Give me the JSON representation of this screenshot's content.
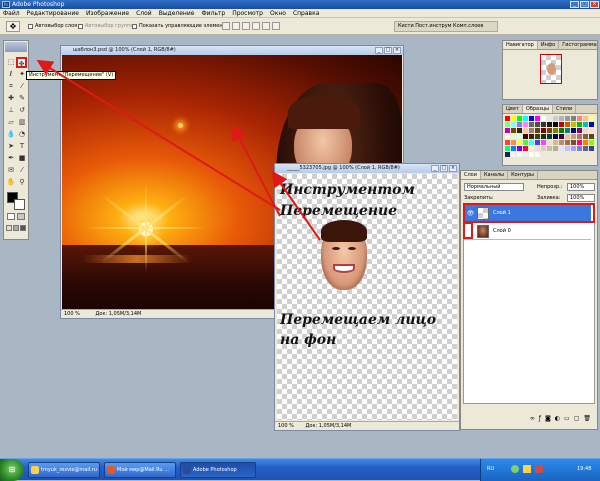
{
  "app": {
    "title": "Adobe Photoshop",
    "logo": "Ps"
  },
  "menu": [
    "Файл",
    "Редактирование",
    "Изображение",
    "Слой",
    "Выделение",
    "Фильтр",
    "Просмотр",
    "Окно",
    "Справка"
  ],
  "options": {
    "auto_select_layer": "Автовыбор слоя",
    "auto_select_group": "Автовыбор группы",
    "show_controls": "Показать управляющие элементы",
    "wells": "Кисти  Пост.инструм  Комп.слоев"
  },
  "tooltip": "Инструмент \"Перемещение\" (V)",
  "doc_bg": {
    "title": "шаблон3.psd @ 100% (Слой 1, RGB/8#)",
    "zoom": "100 %",
    "status": "Док: 1,05М/3,14М"
  },
  "doc_face": {
    "title": "_____5323705.jpg @ 100% (Слой 1, RGB/8#)",
    "zoom": "100 %",
    "status": "Док: 1,05М/3,14М"
  },
  "annotations": {
    "top_line1": "Инструментом",
    "top_line2": "Перемещение",
    "bottom_line1": "Перемещаем лицо",
    "bottom_line2": "на фон"
  },
  "navigator": {
    "tabs": [
      "Навигатор",
      "Инфо",
      "Гистограмма"
    ]
  },
  "swatches": {
    "tabs": [
      "Цвет",
      "Образцы",
      "Стили"
    ],
    "colors": [
      "#ff0000",
      "#ffff00",
      "#00ff00",
      "#00ffff",
      "#0000ff",
      "#ff00ff",
      "#ffffff",
      "#e6e6e6",
      "#cccccc",
      "#b3b3b3",
      "#999999",
      "#808080",
      "#ff8080",
      "#ffc080",
      "#ffff80",
      "#80ff80",
      "#80ffff",
      "#8080ff",
      "#ff80ff",
      "#666666",
      "#4d4d4d",
      "#333333",
      "#1a1a1a",
      "#000000",
      "#c00000",
      "#c06000",
      "#c0c000",
      "#00c000",
      "#00c0c0",
      "#0000c0",
      "#c000c0",
      "#804000",
      "#402000",
      "#f0d0a0",
      "#a08060",
      "#604020",
      "#800000",
      "#804000",
      "#808000",
      "#008000",
      "#008080",
      "#000080",
      "#800080",
      "#ffd0d0",
      "#ffe0c0",
      "#ffffd0",
      "#d0ffd0",
      "#d0ffff",
      "#400000",
      "#402000",
      "#404000",
      "#004000",
      "#004040",
      "#000040",
      "#400040",
      "#e8c0a0",
      "#c0a080",
      "#a08060",
      "#806040",
      "#604020",
      "#ff4040",
      "#ff9040",
      "#ffff40",
      "#40ff40",
      "#40ffff",
      "#4040ff",
      "#ff40ff",
      "#f4e0c8",
      "#d8b898",
      "#b89070",
      "#987050",
      "#785030",
      "#ff0080",
      "#ff8000",
      "#80ff00",
      "#00ff80",
      "#0080ff",
      "#8000ff",
      "#ff0040",
      "#ffeedd",
      "#eeddcc",
      "#ddccbb",
      "#ccbbaa",
      "#bbaa99",
      "#e0e0ff",
      "#c0c0ff",
      "#a0a0ff",
      "#8080c0",
      "#6060a0",
      "#404080",
      "#202060",
      "#fff0f0",
      "#f0fff0",
      "#f0f0ff",
      "#fffff0",
      "#f0ffff"
    ]
  },
  "layers": {
    "tabs": [
      "Слои",
      "Каналы",
      "Контуры"
    ],
    "blend_mode": "Нормальный",
    "opacity_label": "Непрозр.:",
    "opacity_value": "100%",
    "lock_label": "Закрепить:",
    "fill_label": "Заливка:",
    "fill_value": "100%",
    "items": [
      {
        "name": "Слой 1",
        "selected": true
      },
      {
        "name": "Слой 0",
        "selected": false
      }
    ]
  },
  "taskbar": {
    "buttons": [
      "tmyuk_rezvie@mail.ru",
      "Мой мир@Mail.Ru ...",
      "Adobe Photoshop"
    ],
    "lang": "RU",
    "clock": "19:48"
  }
}
